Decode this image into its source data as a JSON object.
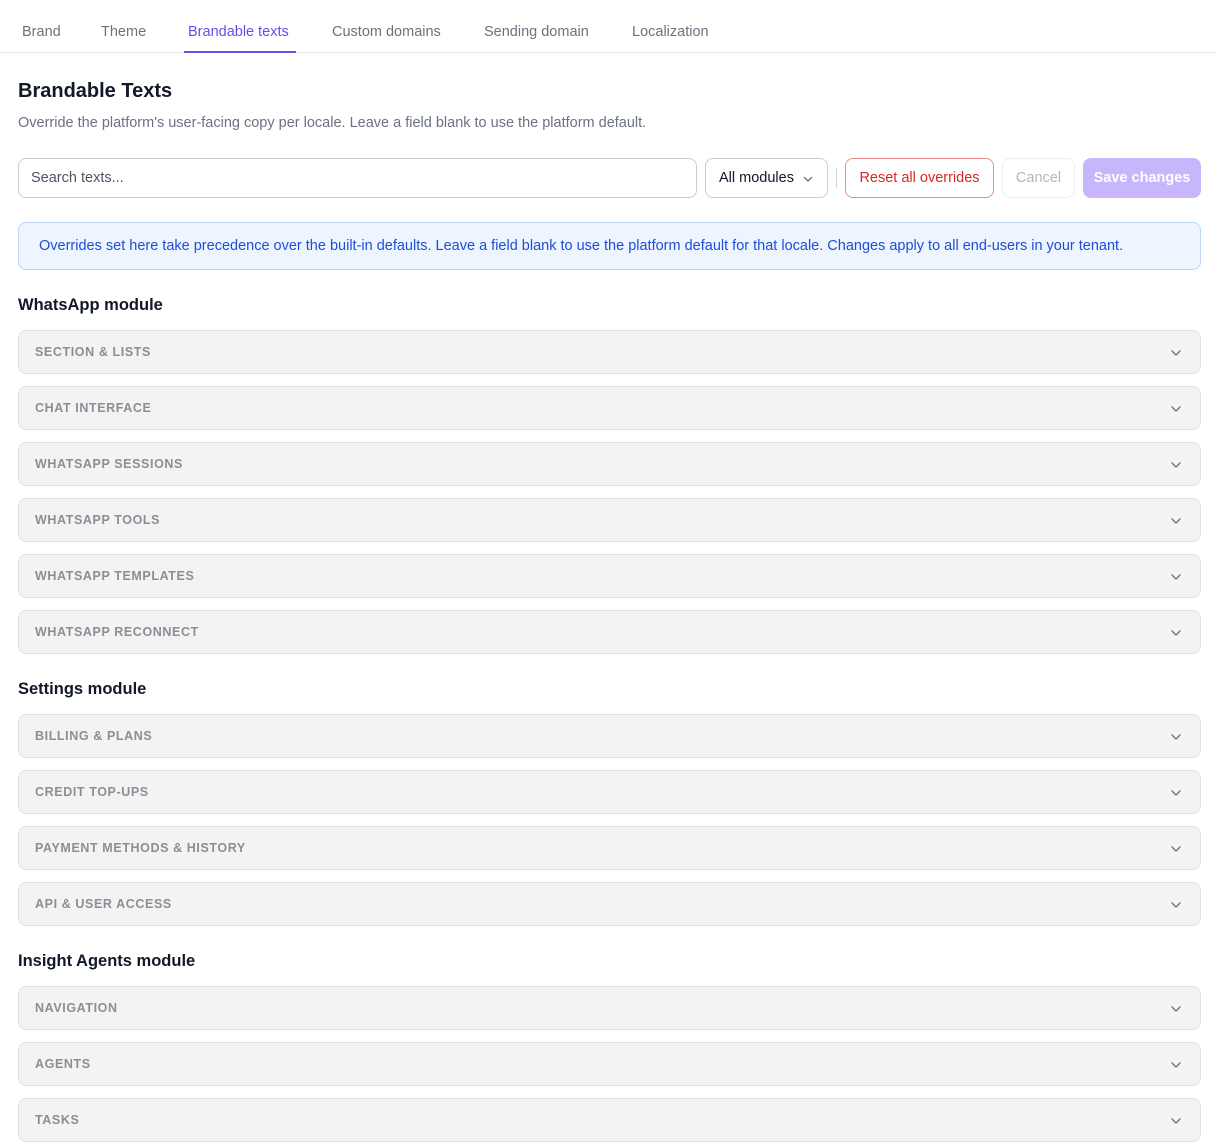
{
  "tabs": [
    {
      "label": "Brand",
      "active": false
    },
    {
      "label": "Theme",
      "active": false
    },
    {
      "label": "Brandable texts",
      "active": true
    },
    {
      "label": "Custom domains",
      "active": false
    },
    {
      "label": "Sending domain",
      "active": false
    },
    {
      "label": "Localization",
      "active": false
    }
  ],
  "header": {
    "title": "Brandable Texts",
    "subtitle": "Override the platform's user-facing copy per locale. Leave a field blank to use the platform default."
  },
  "toolbar": {
    "search_placeholder": "Search texts...",
    "search_value": "",
    "module_filter": "All modules",
    "reset_label": "Reset all overrides",
    "cancel_label": "Cancel",
    "save_label": "Save changes"
  },
  "notice": {
    "text": "Overrides set here take precedence over the built-in defaults. Leave a field blank to use the platform default for that locale. Changes apply to all end-users in your tenant."
  },
  "modules": [
    {
      "title": "WhatsApp module",
      "sections": [
        "SECTION & LISTS",
        "CHAT INTERFACE",
        "WHATSAPP SESSIONS",
        "WHATSAPP TOOLS",
        "WHATSAPP TEMPLATES",
        "WHATSAPP RECONNECT"
      ]
    },
    {
      "title": "Settings module",
      "sections": [
        "BILLING & PLANS",
        "CREDIT TOP-UPS",
        "PAYMENT METHODS & HISTORY",
        "API & USER ACCESS"
      ]
    },
    {
      "title": "Insight Agents module",
      "sections": [
        "NAVIGATION",
        "AGENTS",
        "TASKS"
      ]
    }
  ],
  "colors": {
    "accent": "#6d4aee",
    "danger": "#dc2626",
    "info_text": "#1d4ed8",
    "info_bg": "#eef5ff",
    "save_disabled": "#c7b6fb"
  }
}
